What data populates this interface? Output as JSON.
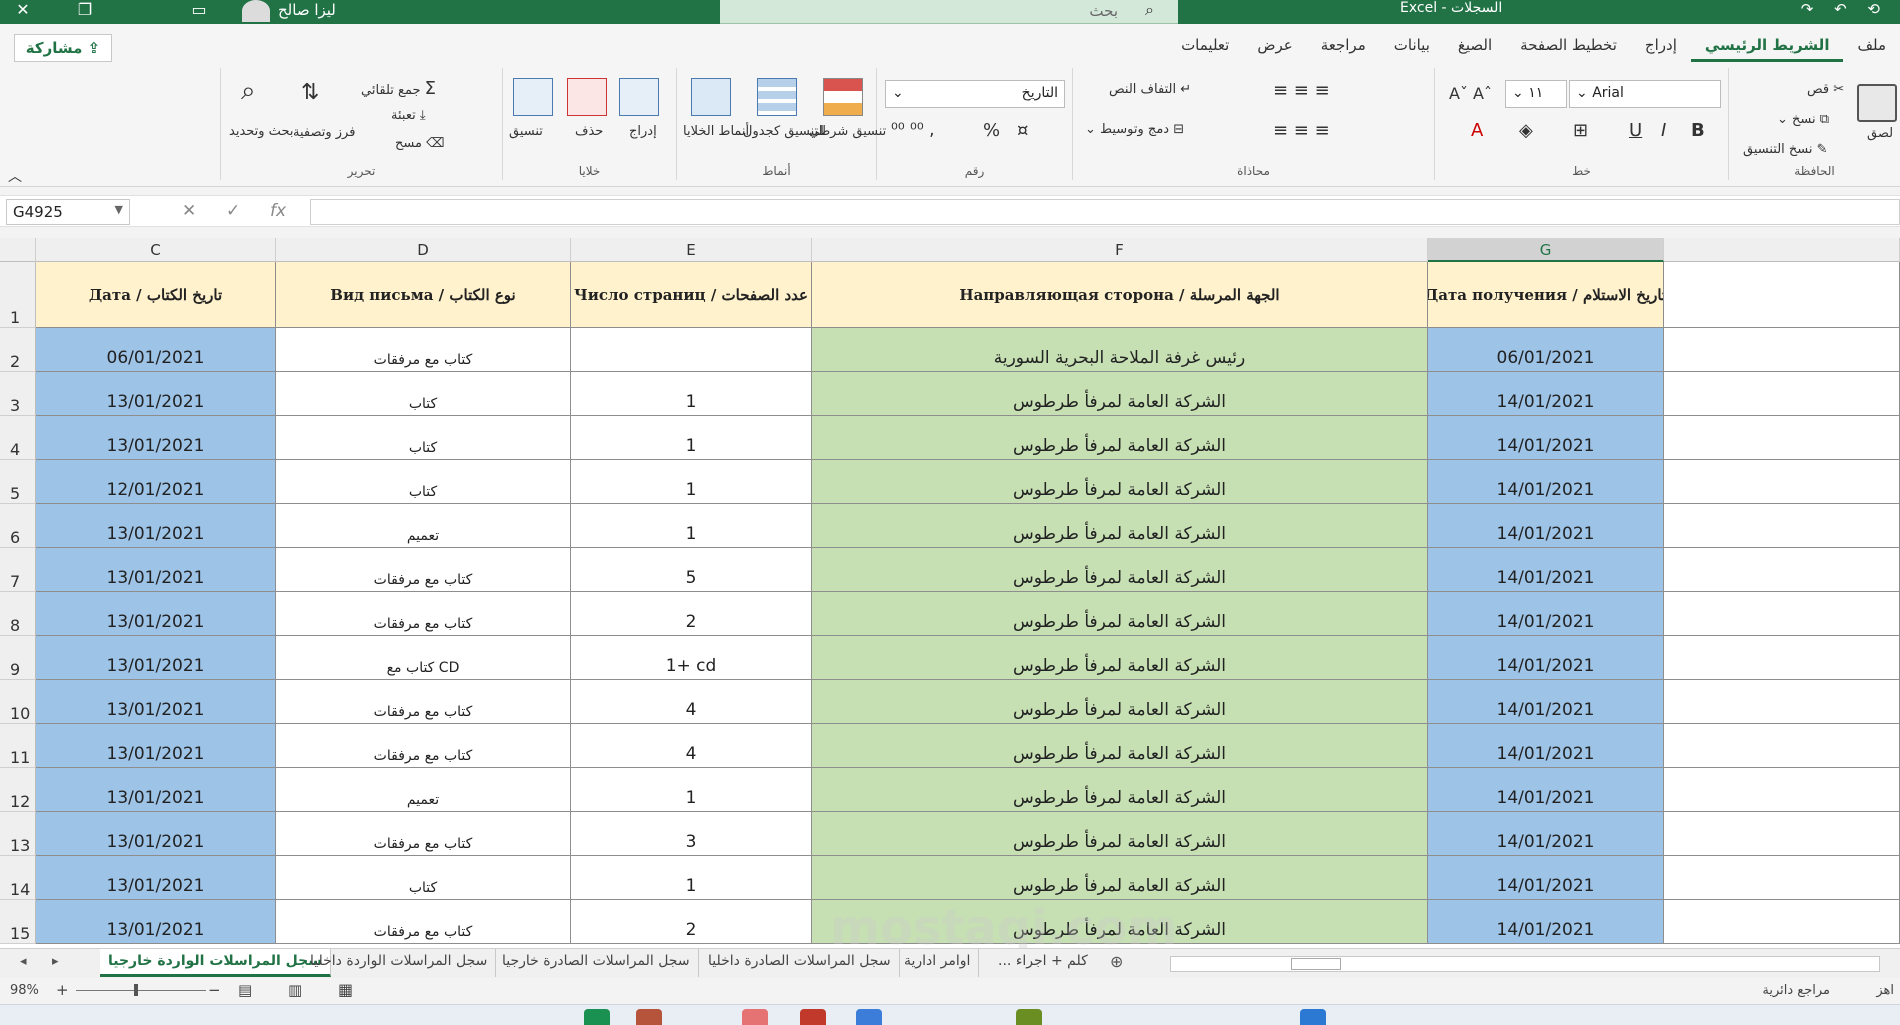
{
  "titlebar": {
    "user_name": "ليزا صالح",
    "search_placeholder": "بحث",
    "app_title": "Excel - السجلات"
  },
  "ribbon": {
    "share_label": "مشاركة",
    "tabs": [
      "ملف",
      "الشريط الرئيسي",
      "إدراج",
      "تخطيط الصفحة",
      "الصيغ",
      "بيانات",
      "مراجعة",
      "عرض",
      "تعليمات"
    ],
    "active_tab": "الشريط الرئيسي",
    "clipboard": {
      "paste": "لصق",
      "cut": "قص",
      "copy": "نسخ",
      "format_painter": "نسخ التنسيق",
      "label": "الحافظة"
    },
    "font": {
      "name": "Arial",
      "size": "١١",
      "label": "خط",
      "bold": "B",
      "italic": "I",
      "underline": "U"
    },
    "alignment": {
      "wrap": "التفاف النص",
      "merge": "دمج وتوسيط",
      "label": "محاذاة"
    },
    "number": {
      "format": "التاريخ",
      "label": "رقم",
      "percent": "%"
    },
    "styles": {
      "conditional": "تنسيق شرطي",
      "table": "التنسيق كجدول",
      "cell_styles": "أنماط الخلايا",
      "label": "أنماط"
    },
    "cells": {
      "insert": "إدراج",
      "delete": "حذف",
      "format": "تنسيق",
      "label": "خلايا"
    },
    "editing": {
      "autosum": "جمع تلقائي",
      "fill": "تعبئة",
      "clear": "مسح",
      "sort_filter": "فرز وتصفية",
      "find_select": "بحث وتحديد",
      "label": "تحرير"
    }
  },
  "formula_bar": {
    "name_box": "G4925",
    "fx": "fx",
    "value": ""
  },
  "sheet": {
    "columns": [
      "C",
      "D",
      "E",
      "F",
      "G"
    ],
    "selected_column": "G",
    "headers": {
      "C": "Дата / تاريخ الكتاب",
      "D": "Вид письма  / نوع الكتاب",
      "E": "Число страниц / عدد الصفحات",
      "F": "Направляющая сторона / الجهة المرسلة",
      "G": "Дата получения / تاريخ الاستلام"
    },
    "rows": [
      {
        "n": "1"
      },
      {
        "n": "2",
        "C": "06/01/2021",
        "D": "كتاب مع مرفقات",
        "E": "",
        "F": "رئيس غرفة الملاحة البحرية السورية",
        "G": "06/01/2021"
      },
      {
        "n": "3",
        "C": "13/01/2021",
        "D": "كتاب",
        "E": "1",
        "F": "الشركة العامة لمرفأ طرطوس",
        "G": "14/01/2021"
      },
      {
        "n": "4",
        "C": "13/01/2021",
        "D": "كتاب",
        "E": "1",
        "F": "الشركة العامة لمرفأ طرطوس",
        "G": "14/01/2021"
      },
      {
        "n": "5",
        "C": "12/01/2021",
        "D": "كتاب",
        "E": "1",
        "F": "الشركة العامة لمرفأ طرطوس",
        "G": "14/01/2021"
      },
      {
        "n": "6",
        "C": "13/01/2021",
        "D": "تعميم",
        "E": "1",
        "F": "الشركة العامة لمرفأ طرطوس",
        "G": "14/01/2021"
      },
      {
        "n": "7",
        "C": "13/01/2021",
        "D": "كتاب مع مرفقات",
        "E": "5",
        "F": "الشركة العامة لمرفأ طرطوس",
        "G": "14/01/2021"
      },
      {
        "n": "8",
        "C": "13/01/2021",
        "D": "كتاب مع مرفقات",
        "E": "2",
        "F": "الشركة العامة لمرفأ طرطوس",
        "G": "14/01/2021"
      },
      {
        "n": "9",
        "C": "13/01/2021",
        "D": "كتاب مع CD",
        "E": "1+ cd",
        "F": "الشركة العامة لمرفأ طرطوس",
        "G": "14/01/2021"
      },
      {
        "n": "10",
        "C": "13/01/2021",
        "D": "كتاب مع مرفقات",
        "E": "4",
        "F": "الشركة العامة لمرفأ طرطوس",
        "G": "14/01/2021"
      },
      {
        "n": "11",
        "C": "13/01/2021",
        "D": "كتاب مع مرفقات",
        "E": "4",
        "F": "الشركة العامة لمرفأ طرطوس",
        "G": "14/01/2021"
      },
      {
        "n": "12",
        "C": "13/01/2021",
        "D": "تعميم",
        "E": "1",
        "F": "الشركة العامة لمرفأ طرطوس",
        "G": "14/01/2021"
      },
      {
        "n": "13",
        "C": "13/01/2021",
        "D": "كتاب مع مرفقات",
        "E": "3",
        "F": "الشركة العامة لمرفأ طرطوس",
        "G": "14/01/2021"
      },
      {
        "n": "14",
        "C": "13/01/2021",
        "D": "كتاب",
        "E": "1",
        "F": "الشركة العامة لمرفأ طرطوس",
        "G": "14/01/2021"
      },
      {
        "n": "15",
        "C": "13/01/2021",
        "D": "كتاب مع مرفقات",
        "E": "2",
        "F": "الشركة العامة لمرفأ طرطوس",
        "G": "14/01/2021"
      }
    ]
  },
  "sheet_tabs": [
    "سجل المراسلات الواردة خارجيا",
    "سجل المراسلات الواردة داخليا",
    "سجل المراسلات الصادرة خارجيا",
    "سجل المراسلات الصادرة داخليا",
    "اوامر ادارية",
    "... كلم + اجراء"
  ],
  "active_sheet": "سجل المراسلات الواردة خارجيا",
  "status": {
    "zoom": "98%",
    "accessibility": "مراجع دائرية",
    "ready": "اهز"
  },
  "watermark": "mostaqi.com",
  "colors": {
    "accent": "#217346",
    "header_fill": "#fff2cc",
    "blue_fill": "#9dc3e6",
    "green_fill": "#c6e0b4"
  }
}
